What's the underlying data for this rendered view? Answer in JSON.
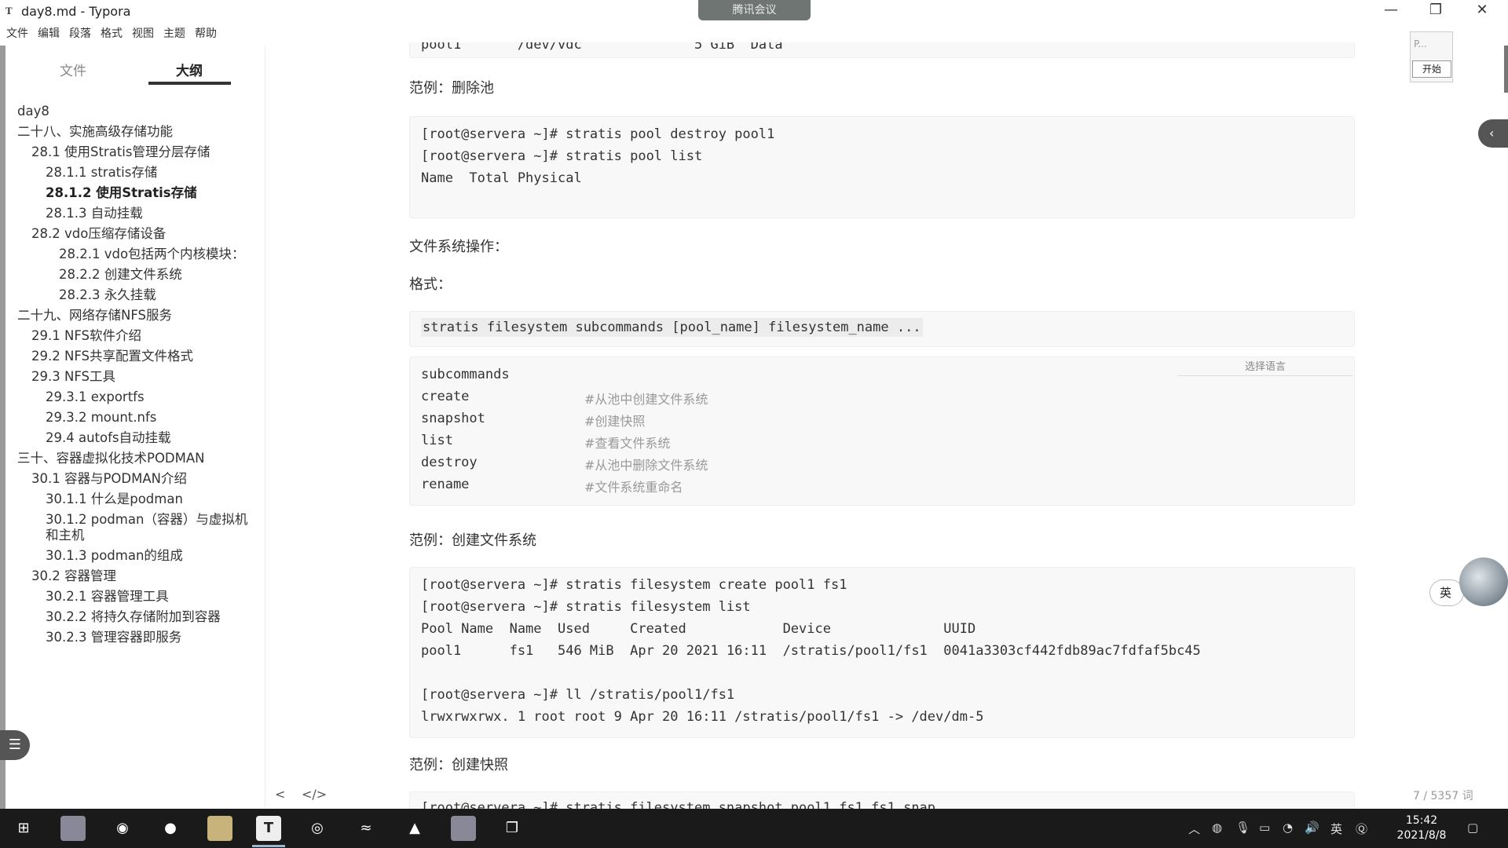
{
  "window": {
    "app_icon": "T",
    "title": "day8.md - Typora",
    "meeting_pill": "腾讯会议",
    "controls": [
      "—",
      "❐",
      "✕"
    ]
  },
  "menu": [
    "文件",
    "编辑",
    "段落",
    "格式",
    "视图",
    "主题",
    "帮助"
  ],
  "sidebar": {
    "tabs": {
      "files": "文件",
      "outline": "大纲"
    },
    "outline": [
      {
        "label": "day8",
        "level": 0
      },
      {
        "label": "二十八、实施高级存储功能",
        "level": 0
      },
      {
        "label": "28.1 使用Stratis管理分层存储",
        "level": 1
      },
      {
        "label": "28.1.1 stratis存储",
        "level": 2
      },
      {
        "label": "28.1.2 使用Stratis存储",
        "level": 2,
        "active": true
      },
      {
        "label": "28.1.3 自动挂载",
        "level": 2
      },
      {
        "label": "28.2 vdo压缩存储设备",
        "level": 1
      },
      {
        "label": "28.2.1 vdo包括两个内核模块：",
        "level": 3
      },
      {
        "label": "28.2.2 创建文件系统",
        "level": 3
      },
      {
        "label": "28.2.3 永久挂载",
        "level": 3
      },
      {
        "label": "二十九、网络存储NFS服务",
        "level": 0
      },
      {
        "label": "29.1 NFS软件介绍",
        "level": 1
      },
      {
        "label": "29.2 NFS共享配置文件格式",
        "level": 1
      },
      {
        "label": "29.3 NFS工具",
        "level": 1
      },
      {
        "label": "29.3.1 exportfs",
        "level": 2
      },
      {
        "label": "29.3.2 mount.nfs",
        "level": 2
      },
      {
        "label": "29.4 autofs自动挂载",
        "level": 2
      },
      {
        "label": "三十、容器虚拟化技术PODMAN",
        "level": 0
      },
      {
        "label": "30.1 容器与PODMAN介绍",
        "level": 1
      },
      {
        "label": "30.1.1 什么是podman",
        "level": 2
      },
      {
        "label": "30.1.2 podman（容器）与虚拟机",
        "level": 2
      },
      {
        "label": "和主机",
        "level": 2
      },
      {
        "label": "30.1.3 podman的组成",
        "level": 2
      },
      {
        "label": "30.2 容器管理",
        "level": 1
      },
      {
        "label": "30.2.1 容器管理工具",
        "level": 2
      },
      {
        "label": "30.2.2 将持久存储附加到容器",
        "level": 2
      },
      {
        "label": "30.2.3 管理容器即服务",
        "level": 2
      }
    ],
    "footer_left": "<",
    "footer_source": "</>"
  },
  "doc": {
    "top_code_partial": "pool1       /dev/vdc              5 GiB  Data",
    "heading_delete": "范例：删除池",
    "code_delete": [
      "[root@servera ~]# stratis pool destroy pool1",
      "[root@servera ~]# stratis pool list",
      "Name  Total Physical"
    ],
    "fs_ops": "文件系统操作：",
    "format_label": "格式：",
    "format_code": "stratis filesystem subcommands [pool_name] filesystem_name ...",
    "lang_select": "选择语言",
    "subcommands": {
      "header": "subcommands",
      "rows": [
        {
          "cmd": "create",
          "comment": "#从池中创建文件系统"
        },
        {
          "cmd": "snapshot",
          "comment": "#创建快照"
        },
        {
          "cmd": "list",
          "comment": "#查看文件系统"
        },
        {
          "cmd": "destroy",
          "comment": "#从池中删除文件系统"
        },
        {
          "cmd": "rename",
          "comment": "#文件系统重命名"
        }
      ]
    },
    "heading_create": "范例：创建文件系统",
    "code_create": [
      "[root@servera ~]# stratis filesystem create pool1 fs1",
      "[root@servera ~]# stratis filesystem list",
      "Pool Name  Name  Used     Created            Device              UUID",
      "pool1      fs1   546 MiB  Apr 20 2021 16:11  /stratis/pool1/fs1  0041a3303cf442fdb89ac7fdfaf5bc45",
      "",
      "[root@servera ~]# ll /stratis/pool1/fs1",
      "lrwxrwxrwx. 1 root root 9 Apr 20 16:11 /stratis/pool1/fs1 -> /dev/dm-5"
    ],
    "heading_snapshot": "范例：创建快照",
    "code_snapshot_partial": "[root@servera ~]# stratis filesystem snapshot pool1 fs1 fs1_snap",
    "word_count": "7 / 5357 词"
  },
  "widgets": {
    "mini_window_label": "P...",
    "mini_window_start": "开始",
    "ime": "英"
  },
  "taskbar": {
    "time": "15:42",
    "date": "2021/8/8",
    "ime": "英"
  }
}
